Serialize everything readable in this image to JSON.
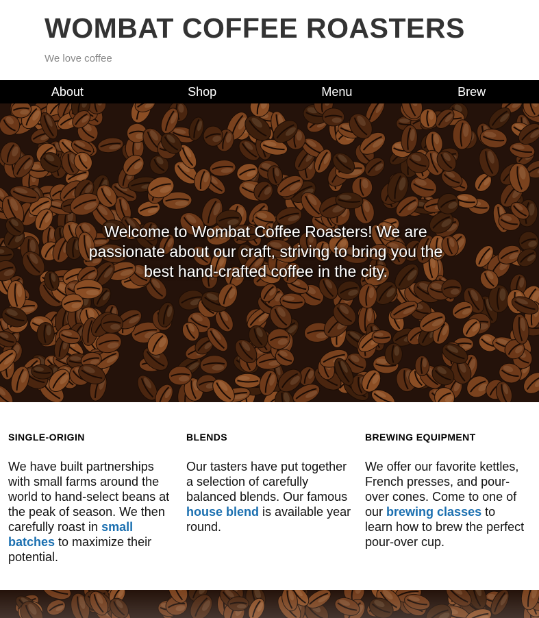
{
  "header": {
    "title": "WOMBAT COFFEE ROASTERS",
    "tagline": "We love coffee"
  },
  "nav": {
    "items": [
      "About",
      "Shop",
      "Menu",
      "Brew"
    ]
  },
  "hero": {
    "text": "Welcome to Wombat Coffee Roasters! We are passionate about our craft, striving to bring you the best hand-crafted coffee in the city."
  },
  "features": [
    {
      "heading": "SINGLE-ORIGIN",
      "text_before": "We have built partnerships with small farms around the world to hand-select beans at the peak of season. We then carefully roast in ",
      "link": "small batches",
      "text_after": " to maximize their potential."
    },
    {
      "heading": "BLENDS",
      "text_before": "Our tasters have put together a selection of carefully balanced blends. Our famous ",
      "link": "house blend",
      "text_after": " is available year round."
    },
    {
      "heading": "BREWING EQUIPMENT",
      "text_before": "We offer our favorite kettles, French presses, and pour-over cones. Come to one of our ",
      "link": "brewing classes",
      "text_after": " to learn how to brew the perfect pour-over cup."
    }
  ],
  "colors": {
    "nav_bg": "#000000",
    "link": "#1a6fb0",
    "title": "#333333",
    "tagline": "#888888"
  }
}
